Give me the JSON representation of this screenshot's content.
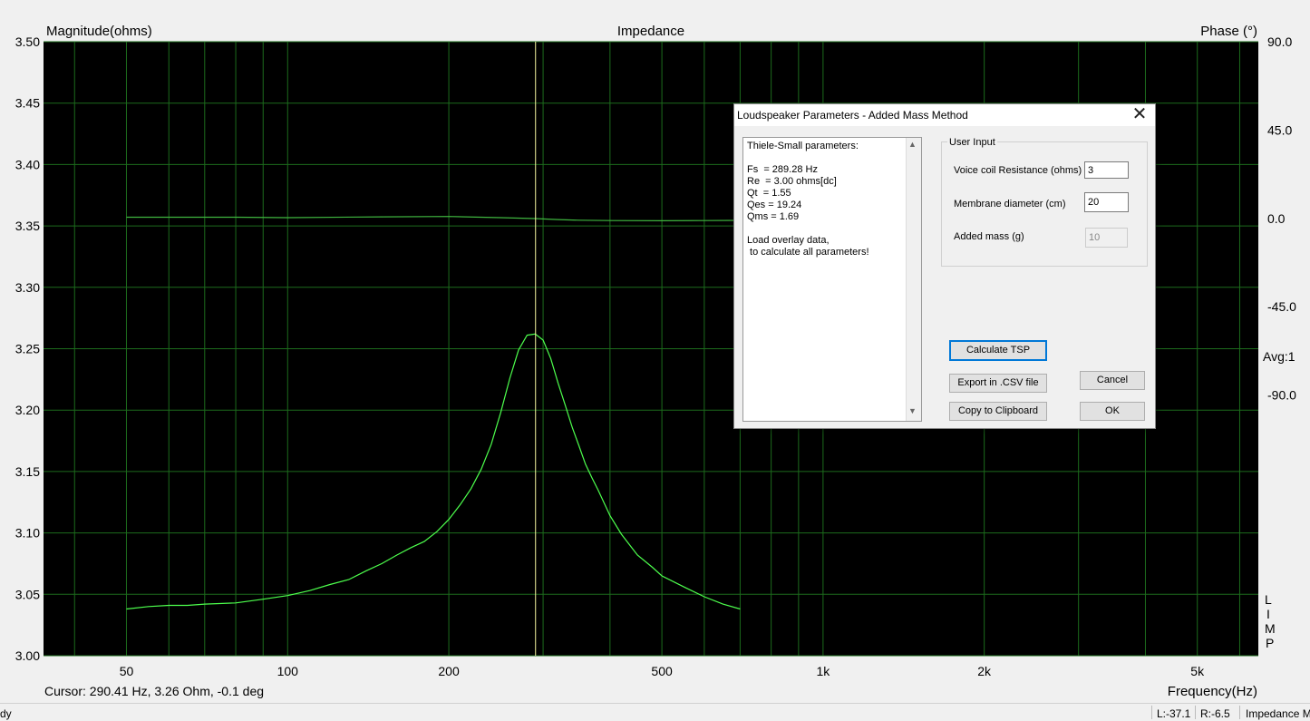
{
  "chart_data": {
    "type": "line",
    "title": "Impedance",
    "left_axis_label": "Magnitude(ohms)",
    "right_axis_label": "Phase (°)",
    "x_axis_label": "Frequency(Hz)",
    "x_scale": "log",
    "xlim": [
      35,
      6500
    ],
    "ylim_left": [
      3.0,
      3.5
    ],
    "ylim_right": [
      -222.75,
      90.0
    ],
    "y_ticks_left": [
      "3.00",
      "3.05",
      "3.10",
      "3.15",
      "3.20",
      "3.25",
      "3.30",
      "3.35",
      "3.40",
      "3.45",
      "3.50"
    ],
    "y_ticks_right": [
      "90.0",
      "45.0",
      "0.0",
      "-45.0",
      "-90.0"
    ],
    "x_ticks": [
      {
        "value": 50,
        "label": "50"
      },
      {
        "value": 100,
        "label": "100"
      },
      {
        "value": 200,
        "label": "200"
      },
      {
        "value": 500,
        "label": "500"
      },
      {
        "value": 1000,
        "label": "1k"
      },
      {
        "value": 2000,
        "label": "2k"
      },
      {
        "value": 5000,
        "label": "5k"
      }
    ],
    "grid": true,
    "cursor_x": 290.41,
    "series": [
      {
        "axis": "left",
        "color": "#4dff4d",
        "x": [
          50,
          55,
          60,
          65,
          70,
          80,
          90,
          100,
          110,
          120,
          130,
          140,
          150,
          160,
          170,
          180,
          190,
          200,
          210,
          220,
          230,
          240,
          250,
          260,
          270,
          280,
          290,
          300,
          310,
          320,
          330,
          340,
          350,
          360,
          370,
          380,
          400,
          420,
          450,
          480,
          500,
          550,
          600,
          650,
          700
        ],
        "y": [
          3.038,
          3.04,
          3.041,
          3.041,
          3.042,
          3.043,
          3.046,
          3.049,
          3.053,
          3.058,
          3.062,
          3.069,
          3.075,
          3.082,
          3.088,
          3.093,
          3.101,
          3.111,
          3.123,
          3.136,
          3.152,
          3.172,
          3.198,
          3.226,
          3.249,
          3.261,
          3.262,
          3.257,
          3.242,
          3.222,
          3.204,
          3.186,
          3.171,
          3.156,
          3.145,
          3.135,
          3.114,
          3.099,
          3.082,
          3.072,
          3.065,
          3.056,
          3.048,
          3.042,
          3.038
        ]
      },
      {
        "axis": "right",
        "color": "#3fb53f",
        "x": [
          50,
          80,
          100,
          150,
          200,
          250,
          290,
          320,
          350,
          400,
          500,
          600,
          700
        ],
        "y": [
          0.6,
          0.6,
          0.4,
          0.8,
          1.0,
          0.4,
          -0.1,
          -0.6,
          -0.9,
          -1.1,
          -1.2,
          -1.1,
          -1.0
        ]
      }
    ]
  },
  "side_text": {
    "avg": "Avg:1",
    "limp": [
      "L",
      "I",
      "M",
      "P"
    ]
  },
  "cursor_readout": "Cursor: 290.41 Hz, 3.26 Ohm, -0.1 deg",
  "status": {
    "left": "dy",
    "l_level": "L:-37.1",
    "r_level": "R:-6.5",
    "mode": "Impedance M"
  },
  "dialog": {
    "title": "Loudspeaker Parameters - Added Mass Method",
    "results_text": "Thiele-Small parameters:\n\nFs  = 289.28 Hz\nRe  = 3.00 ohms[dc]\nQt  = 1.55\nQes = 19.24\nQms = 1.69\n\nLoad overlay data,\n to calculate all parameters!",
    "group_title": "User Input",
    "fields": {
      "voice_coil_label": "Voice coil Resistance (ohms)",
      "voice_coil_value": "3",
      "membrane_label": "Membrane diameter (cm)",
      "membrane_value": "20",
      "added_mass_label": "Added mass (g)",
      "added_mass_value": "10"
    },
    "buttons": {
      "calculate": "Calculate TSP",
      "export": "Export in .CSV file",
      "copy": "Copy to Clipboard",
      "cancel": "Cancel",
      "ok": "OK"
    }
  }
}
